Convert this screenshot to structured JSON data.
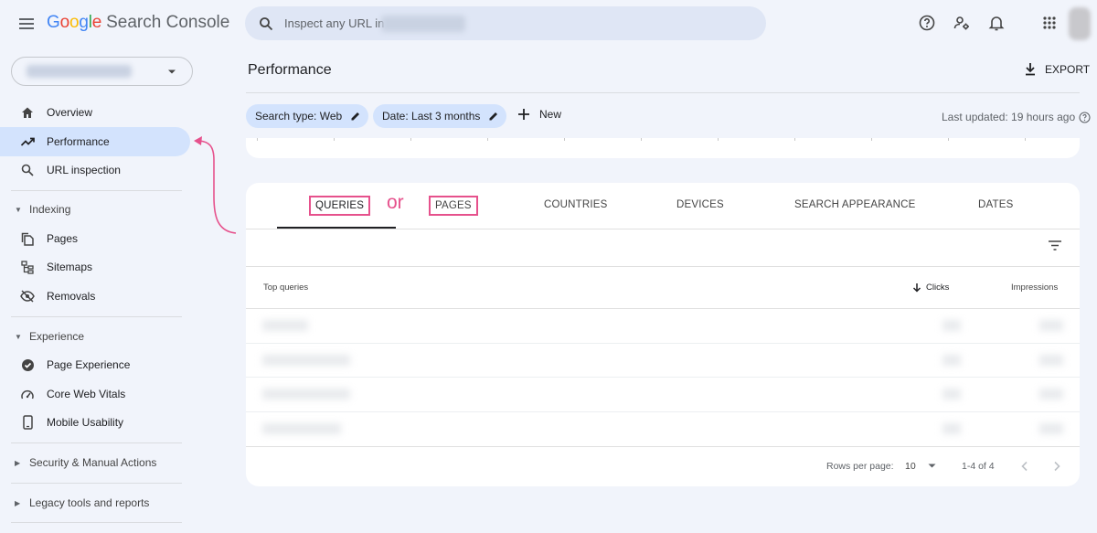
{
  "app": {
    "brand": "Google",
    "product": "Search Console"
  },
  "search": {
    "placeholder": "Inspect any URL in"
  },
  "icons": {
    "menu": "menu-icon",
    "search": "search-icon",
    "help": "help-icon",
    "admin": "manage-accounts-icon",
    "notifications": "bell-icon",
    "apps": "apps-grid-icon"
  },
  "sidebar": {
    "items": [
      {
        "label": "Overview",
        "icon": "home-icon"
      },
      {
        "label": "Performance",
        "icon": "trending-up-icon"
      },
      {
        "label": "URL inspection",
        "icon": "search-icon"
      }
    ],
    "indexing": {
      "title": "Indexing",
      "items": [
        {
          "label": "Pages",
          "icon": "pages-icon"
        },
        {
          "label": "Sitemaps",
          "icon": "sitemap-icon"
        },
        {
          "label": "Removals",
          "icon": "visibility-off-icon"
        }
      ]
    },
    "experience": {
      "title": "Experience",
      "items": [
        {
          "label": "Page Experience",
          "icon": "page-experience-icon"
        },
        {
          "label": "Core Web Vitals",
          "icon": "speedometer-icon"
        },
        {
          "label": "Mobile Usability",
          "icon": "phone-icon"
        }
      ]
    },
    "security": {
      "title": "Security & Manual Actions"
    },
    "legacy": {
      "title": "Legacy tools and reports"
    }
  },
  "header": {
    "title": "Performance",
    "export_label": "EXPORT",
    "chips": [
      "Search type: Web",
      "Date: Last 3 months"
    ],
    "new_label": "New",
    "last_updated": "Last updated: 19 hours ago"
  },
  "tabs": [
    "QUERIES",
    "PAGES",
    "COUNTRIES",
    "DEVICES",
    "SEARCH APPEARANCE",
    "DATES"
  ],
  "annotation": {
    "or_text": "or"
  },
  "table": {
    "headers": {
      "query": "Top queries",
      "clicks": "Clicks",
      "impressions": "Impressions"
    },
    "footer": {
      "rows_per_page_label": "Rows per page:",
      "rows_per_page_value": "10",
      "range": "1-4 of 4"
    }
  },
  "colors": {
    "accent": "#d3e3fd",
    "annotation": "#e6518c",
    "background": "#f1f4fb"
  }
}
